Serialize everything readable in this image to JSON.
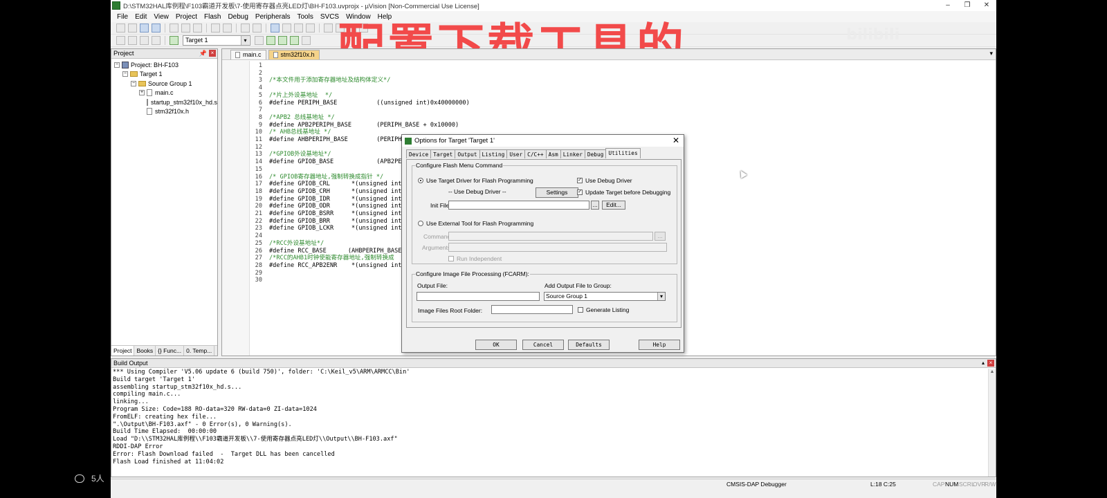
{
  "window": {
    "title": "D:\\STM32HAL库例程\\F103霸道开发板\\7-使用寄存器点亮LED灯\\BH-F103.uvprojx - µVision  [Non-Commercial Use License]",
    "controls": [
      "–",
      "❐",
      "✕"
    ]
  },
  "menu": [
    "File",
    "Edit",
    "View",
    "Project",
    "Flash",
    "Debug",
    "Peripherals",
    "Tools",
    "SVCS",
    "Window",
    "Help"
  ],
  "toolbar": {
    "target_select": "Target 1"
  },
  "overlay": {
    "caption": "配置下载工具的",
    "brand": "bilibili"
  },
  "project_panel": {
    "title": "Project",
    "tree": [
      "Project: BH-F103",
      "Target 1",
      "Source Group 1",
      "main.c",
      "startup_stm32f10x_hd.s",
      "stm32f10x.h"
    ],
    "tabs": [
      "Project",
      "Books",
      "{} Func...",
      "0. Temp..."
    ]
  },
  "editor": {
    "tabs": [
      "main.c",
      "stm32f10x.h"
    ],
    "lines": [
      {
        "n": "1",
        "t": ""
      },
      {
        "n": "2",
        "t": ""
      },
      {
        "n": "3",
        "t": "/*本文件用于添加寄存器地址及结构体定义*/",
        "cls": "cm"
      },
      {
        "n": "4",
        "t": ""
      },
      {
        "n": "5",
        "t": "/*片上外设基地址  */",
        "cls": "cm"
      },
      {
        "n": "6",
        "t": "#define PERIPH_BASE           ((unsigned int)0x40000000)"
      },
      {
        "n": "7",
        "t": ""
      },
      {
        "n": "8",
        "t": "/*APB2 总线基地址 */",
        "cls": "cm"
      },
      {
        "n": "9",
        "t": "#define APB2PERIPH_BASE       (PERIPH_BASE + 0x10000)"
      },
      {
        "n": "10",
        "t": "/* AHB总线基地址 */",
        "cls": "cm"
      },
      {
        "n": "11",
        "t": "#define AHBPERIPH_BASE        (PERIPH_BA"
      },
      {
        "n": "12",
        "t": ""
      },
      {
        "n": "13",
        "t": "/*GPIOB外设基地址*/",
        "cls": "cm"
      },
      {
        "n": "14",
        "t": "#define GPIOB_BASE            (APB2PERIP"
      },
      {
        "n": "15",
        "t": ""
      },
      {
        "n": "16",
        "t": "/* GPIOB寄存器地址,强制转换成指针 */",
        "cls": "cm"
      },
      {
        "n": "17",
        "t": "#define GPIOB_CRL      *(unsigned int*)(G"
      },
      {
        "n": "18",
        "t": "#define GPIOB_CRH      *(unsigned int*)(G"
      },
      {
        "n": "19",
        "t": "#define GPIOB_IDR      *(unsigned int*)(G"
      },
      {
        "n": "20",
        "t": "#define GPIOB_ODR      *(unsigned int*)(G"
      },
      {
        "n": "21",
        "t": "#define GPIOB_BSRR     *(unsigned int*)(G"
      },
      {
        "n": "22",
        "t": "#define GPIOB_BRR      *(unsigned int*)(G"
      },
      {
        "n": "23",
        "t": "#define GPIOB_LCKR     *(unsigned int*)(G"
      },
      {
        "n": "24",
        "t": ""
      },
      {
        "n": "25",
        "t": "/*RCC外设基地址*/",
        "cls": "cm"
      },
      {
        "n": "26",
        "t": "#define RCC_BASE      (AHBPERIPH_BASE +"
      },
      {
        "n": "27",
        "t": "/*RCC的AHB1时钟使能寄存器地址,强制转换成",
        "cls": "cm"
      },
      {
        "n": "28",
        "t": "#define RCC_APB2ENR    *(unsigned int*)("
      },
      {
        "n": "29",
        "t": ""
      },
      {
        "n": "30",
        "t": ""
      }
    ]
  },
  "dialog": {
    "title": "Options for Target 'Target 1'",
    "tabs": [
      "Device",
      "Target",
      "Output",
      "Listing",
      "User",
      "C/C++",
      "Asm",
      "Linker",
      "Debug",
      "Utilities"
    ],
    "menu_group": "Configure Flash Menu Command",
    "use_target_driver": "Use Target Driver for Flash Programming",
    "use_debug_driver_sel": "-- Use Debug Driver --",
    "settings": "Settings",
    "use_debug_driver_chk": "Use Debug Driver",
    "update_target": "Update Target before Debugging",
    "init_file": "Init File:",
    "browse": "...",
    "edit": "Edit...",
    "use_external": "Use External Tool for Flash Programming",
    "command": "Command:",
    "arguments": "Arguments:",
    "run_independent": "Run Independent",
    "image_group": "Configure Image File Processing (FCARM):",
    "output_file": "Output File:",
    "add_output": "Add Output File  to Group:",
    "group_value": "Source Group 1",
    "root_folder": "Image Files Root Folder:",
    "generate_listing": "Generate Listing",
    "buttons": [
      "OK",
      "Cancel",
      "Defaults",
      "Help"
    ]
  },
  "build": {
    "title": "Build Output",
    "lines": [
      "*** Using Compiler 'V5.06 update 6 (build 750)', folder: 'C:\\Keil_v5\\ARM\\ARMCC\\Bin'",
      "Build target 'Target 1'",
      "assembling startup_stm32f10x_hd.s...",
      "compiling main.c...",
      "linking...",
      "Program Size: Code=188 RO-data=320 RW-data=0 ZI-data=1024",
      "FromELF: creating hex file...",
      "\".\\Output\\BH-F103.axf\" - 0 Error(s), 0 Warning(s).",
      "Build Time Elapsed:  00:00:00",
      "Load \"D:\\\\STM32HAL库例程\\\\F103霸道开发板\\\\7-使用寄存器点亮LED灯\\\\Output\\\\BH-F103.axf\"",
      "RDDI-DAP Error",
      "Error: Flash Download failed  -  Target DLL has been cancelled",
      "Flash Load finished at 11:04:02"
    ]
  },
  "status": {
    "debugger": "CMSIS-DAP Debugger",
    "position": "L:18 C:25",
    "cap": "CAP",
    "num": "NUM",
    "scrl": "SCRL",
    "ovr": "OVR",
    "rw": "R/W"
  },
  "viewer": {
    "count": "5人"
  }
}
